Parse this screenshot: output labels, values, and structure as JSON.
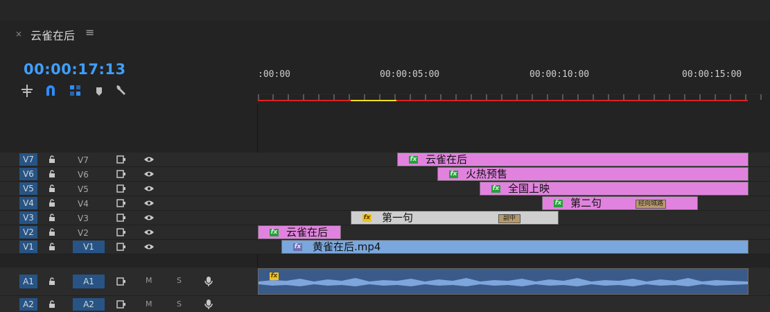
{
  "sequence": {
    "title": "云雀在后",
    "timecode": "00:00:17:13"
  },
  "ruler": {
    "labels": [
      ":00:00",
      "00:00:05:00",
      "00:00:10:00",
      "00:00:15:00"
    ]
  },
  "video_tracks": [
    {
      "patch": "V7",
      "name": "V7"
    },
    {
      "patch": "V6",
      "name": "V6"
    },
    {
      "patch": "V5",
      "name": "V5"
    },
    {
      "patch": "V4",
      "name": "V4"
    },
    {
      "patch": "V3",
      "name": "V3"
    },
    {
      "patch": "V2",
      "name": "V2"
    },
    {
      "patch": "V1",
      "name": "V1"
    }
  ],
  "audio_tracks": [
    {
      "patch": "A1",
      "name": "A1",
      "m": "M",
      "s": "S"
    },
    {
      "patch": "A2",
      "name": "A2",
      "m": "M",
      "s": "S"
    }
  ],
  "clips": {
    "v7": {
      "label": "云雀在后"
    },
    "v6": {
      "label": "火热预售"
    },
    "v5": {
      "label": "全国上映"
    },
    "v4": {
      "label": "第二句",
      "sub": "经向城路"
    },
    "v3": {
      "label": "第一句",
      "sub": "副中"
    },
    "v2": {
      "label": "云雀在后"
    },
    "v1": {
      "label": "黄雀在后.mp4"
    }
  },
  "colors": {
    "accent_blue": "#3f9fff",
    "title_clip_pink": "#e183de",
    "video_clip_blue": "#7aa7dd",
    "gray_clip": "#cfcfcf",
    "audio_clip": "#3a5a8a",
    "fx_green": "#2a9d3e",
    "fx_yellow": "#f0c419",
    "render_red": "#e02020",
    "render_yellow": "#f0e020"
  },
  "icons": {
    "tools": [
      "nest-icon",
      "snap-magnet-icon",
      "linked-selection-icon",
      "add-marker-icon",
      "wrench-icon"
    ],
    "track": [
      "lock-icon",
      "toggle-output-icon",
      "eye-icon",
      "mic-icon"
    ]
  }
}
